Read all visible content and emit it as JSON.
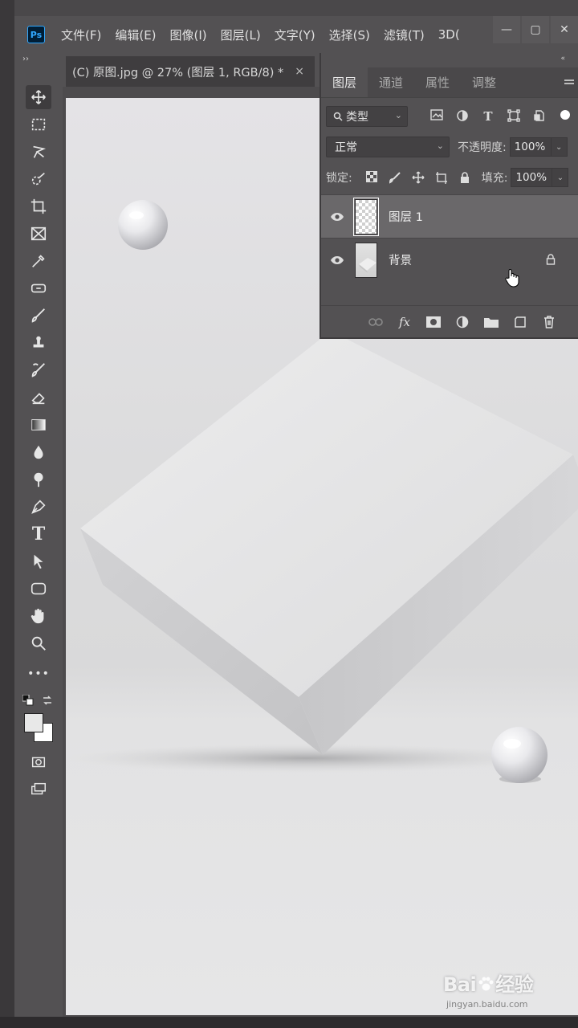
{
  "app": {
    "logo": "Ps"
  },
  "menu": {
    "items": [
      "文件(F)",
      "编辑(E)",
      "图像(I)",
      "图层(L)",
      "文字(Y)",
      "选择(S)",
      "滤镜(T)",
      "3D("
    ]
  },
  "window_controls": {
    "minimize": "—",
    "maximize": "▢",
    "close": "✕"
  },
  "toolbar": {
    "collapse": "››",
    "tools": [
      "move-icon",
      "marquee-icon",
      "lasso-icon",
      "quick-select-icon",
      "crop-icon",
      "frame-icon",
      "eyedropper-icon",
      "healing-icon",
      "brush-icon",
      "stamp-icon",
      "history-brush-icon",
      "eraser-icon",
      "gradient-icon",
      "blur-icon",
      "dodge-icon",
      "pen-icon",
      "type-icon",
      "path-select-icon",
      "shape-icon",
      "hand-icon",
      "zoom-icon",
      "more-icon"
    ],
    "type_glyph": "T",
    "more_glyph": "•••"
  },
  "document": {
    "tab_title": "(C) 原图.jpg @ 27% (图层 1, RGB/8) *",
    "close": "×"
  },
  "layers_panel": {
    "collapse": "«",
    "tabs": [
      "图层",
      "通道",
      "属性",
      "调整"
    ],
    "filter": {
      "value": "类型"
    },
    "blend_mode": "正常",
    "opacity_label": "不透明度:",
    "opacity_value": "100%",
    "lock_label": "锁定:",
    "fill_label": "填充:",
    "fill_value": "100%",
    "layers": [
      {
        "name": "图层 1",
        "visible": true,
        "selected": true,
        "thumb": "transparent"
      },
      {
        "name": "背景",
        "visible": true,
        "selected": false,
        "thumb": "image",
        "locked": true
      }
    ],
    "bottom_icons": [
      "link-icon",
      "fx-icon",
      "mask-icon",
      "adjustment-icon",
      "folder-icon",
      "new-layer-icon",
      "trash-icon"
    ],
    "fx_glyph": "fx"
  },
  "watermark": {
    "brand": "Bai",
    "brand2": "经验",
    "url": "jingyan.baidu.com"
  },
  "colors": {
    "ps_blue": "#31a8ff",
    "panel_bg": "#535153",
    "selected_layer": "#6a686a"
  }
}
